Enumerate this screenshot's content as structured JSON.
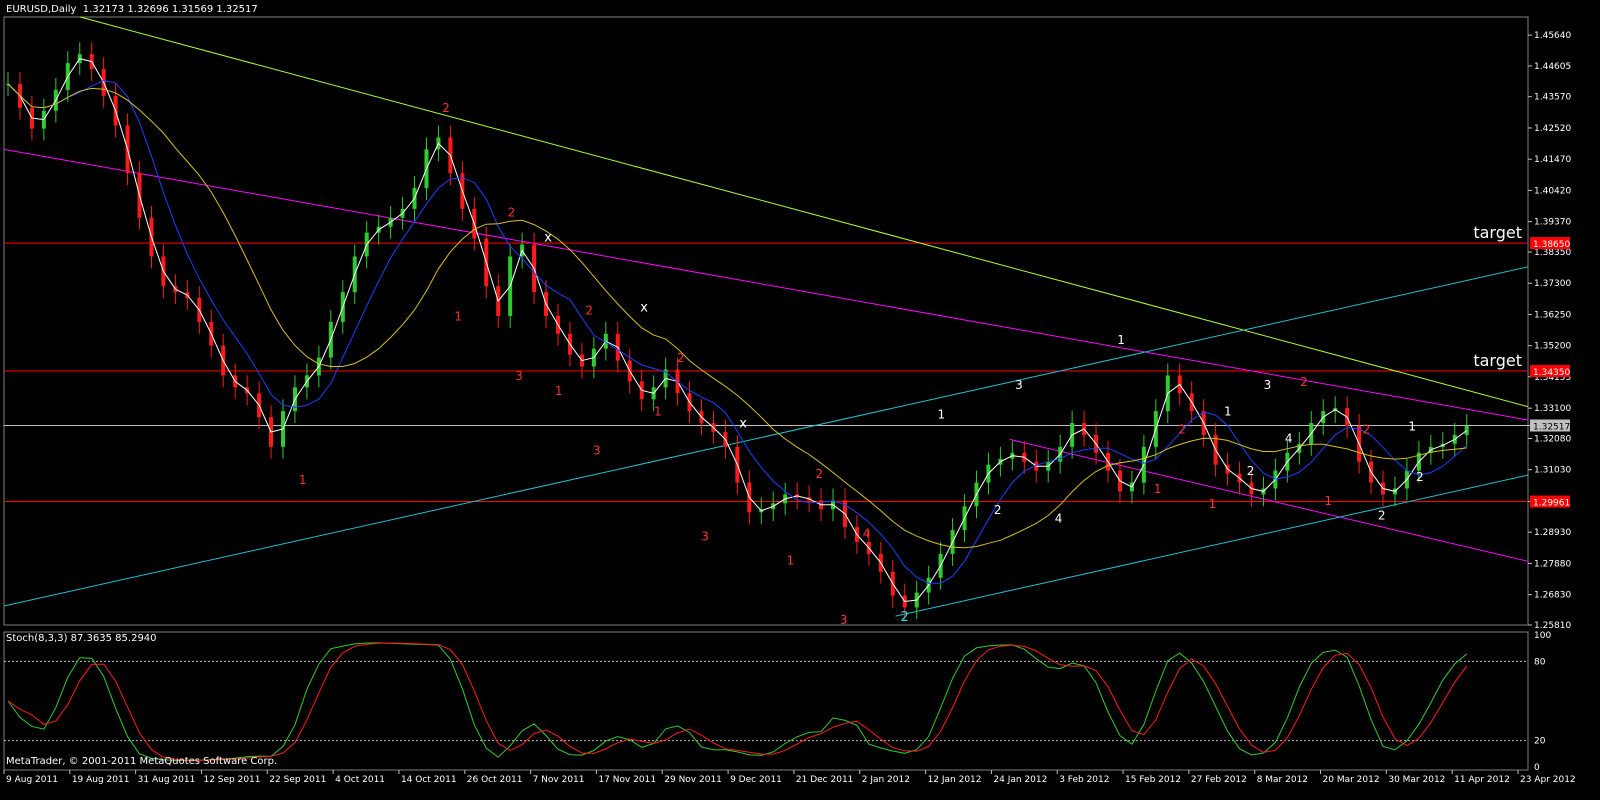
{
  "header": {
    "symbol_label": "EURUSD,Daily",
    "ohlc": "1.32173 1.32696 1.31569 1.32517"
  },
  "indicator": {
    "label": "Stoch(8,3,3) 87.3635 85.2940",
    "levels": [
      "100",
      "80",
      "20",
      "0"
    ]
  },
  "copyright": "MetaTrader, © 2001-2011 MetaQuotes Software Corp.",
  "chart_data": {
    "type": "candlestick",
    "symbol": "EURUSD",
    "timeframe": "Daily",
    "price_axis_labels": [
      "1.45640",
      "1.44605",
      "1.43570",
      "1.42520",
      "1.41470",
      "1.40420",
      "1.39370",
      "1.38350",
      "1.37300",
      "1.36250",
      "1.35200",
      "1.34155",
      "1.33100",
      "1.32517",
      "1.32080",
      "1.31030",
      "1.29961",
      "1.28930",
      "1.27880",
      "1.26830",
      "1.25810"
    ],
    "ylim": [
      1.2581,
      1.4625
    ],
    "time_axis_labels": [
      "9 Aug 2011",
      "19 Aug 2011",
      "31 Aug 2011",
      "12 Sep 2011",
      "22 Sep 2011",
      "4 Oct 2011",
      "14 Oct 2011",
      "26 Oct 2011",
      "7 Nov 2011",
      "17 Nov 2011",
      "29 Nov 2011",
      "9 Dec 2011",
      "21 Dec 2011",
      "2 Jan 2012",
      "12 Jan 2012",
      "24 Jan 2012",
      "3 Feb 2012",
      "15 Feb 2012",
      "27 Feb 2012",
      "8 Mar 2012",
      "20 Mar 2012",
      "30 Mar 2012",
      "11 Apr 2012",
      "23 Apr 2012"
    ],
    "current_price": 1.32517,
    "price_series": [
      1.44,
      1.432,
      1.425,
      1.431,
      1.438,
      1.447,
      1.45,
      1.445,
      1.436,
      1.426,
      1.41,
      1.395,
      1.382,
      1.372,
      1.37,
      1.368,
      1.36,
      1.352,
      1.342,
      1.338,
      1.336,
      1.328,
      1.318,
      1.33,
      1.338,
      1.342,
      1.348,
      1.36,
      1.37,
      1.382,
      1.39,
      1.392,
      1.395,
      1.398,
      1.405,
      1.418,
      1.422,
      1.41,
      1.398,
      1.388,
      1.372,
      1.362,
      1.382,
      1.386,
      1.37,
      1.362,
      1.356,
      1.349,
      1.345,
      1.351,
      1.356,
      1.347,
      1.34,
      1.334,
      1.338,
      1.344,
      1.336,
      1.33,
      1.326,
      1.323,
      1.318,
      1.306,
      1.296,
      1.297,
      1.299,
      1.302,
      1.301,
      1.3,
      1.297,
      1.3,
      1.291,
      1.286,
      1.282,
      1.276,
      1.268,
      1.264,
      1.269,
      1.274,
      1.282,
      1.29,
      1.298,
      1.306,
      1.312,
      1.314,
      1.316,
      1.313,
      1.31,
      1.313,
      1.318,
      1.326,
      1.322,
      1.316,
      1.31,
      1.303,
      1.306,
      1.318,
      1.33,
      1.342,
      1.336,
      1.33,
      1.322,
      1.312,
      1.309,
      1.306,
      1.302,
      1.304,
      1.31,
      1.316,
      1.319,
      1.326,
      1.33,
      1.331,
      1.325,
      1.313,
      1.306,
      1.302,
      1.304,
      1.31,
      1.316,
      1.318,
      1.319,
      1.322,
      1.325
    ],
    "horizontal_lines": [
      {
        "price": 1.3865,
        "label": "target",
        "color": "#ff0000"
      },
      {
        "price": 1.3435,
        "label": "target",
        "color": "#ff0000"
      },
      {
        "price": 1.32517,
        "label": "",
        "color": "#c0c0c0"
      },
      {
        "price": 1.29961,
        "label": "",
        "color": "#ff0000"
      }
    ],
    "annotations": [
      {
        "text": "2",
        "color": "#ff3030",
        "t": 0.29,
        "p": 1.4305
      },
      {
        "text": "2",
        "color": "#ff3030",
        "t": 0.333,
        "p": 1.3955
      },
      {
        "text": "x",
        "color": "#ffffff",
        "t": 0.357,
        "p": 1.387
      },
      {
        "text": "1",
        "color": "#ff3030",
        "t": 0.196,
        "p": 1.3055
      },
      {
        "text": "1",
        "color": "#ff3030",
        "t": 0.298,
        "p": 1.3605
      },
      {
        "text": "3",
        "color": "#ff3030",
        "t": 0.338,
        "p": 1.3405
      },
      {
        "text": "1",
        "color": "#ff3030",
        "t": 0.364,
        "p": 1.3355
      },
      {
        "text": "2",
        "color": "#ff3030",
        "t": 0.384,
        "p": 1.3625
      },
      {
        "text": "x",
        "color": "#ffffff",
        "t": 0.42,
        "p": 1.3635
      },
      {
        "text": "3",
        "color": "#ff3030",
        "t": 0.389,
        "p": 1.3155
      },
      {
        "text": "1",
        "color": "#ff3030",
        "t": 0.429,
        "p": 1.3285
      },
      {
        "text": "2",
        "color": "#ff3030",
        "t": 0.444,
        "p": 1.3465
      },
      {
        "text": "x",
        "color": "#ffffff",
        "t": 0.485,
        "p": 1.3245
      },
      {
        "text": "3",
        "color": "#ff3030",
        "t": 0.46,
        "p": 1.2865
      },
      {
        "text": "1",
        "color": "#ff3030",
        "t": 0.516,
        "p": 1.2785
      },
      {
        "text": "2",
        "color": "#ff3030",
        "t": 0.535,
        "p": 1.3075
      },
      {
        "text": "4",
        "color": "#ff3030",
        "t": 0.566,
        "p": 1.2875
      },
      {
        "text": "3",
        "color": "#ff3030",
        "t": 0.551,
        "p": 1.2585
      },
      {
        "text": "2",
        "color": "#20e0e0",
        "t": 0.591,
        "p": 1.2595
      },
      {
        "text": "1",
        "color": "#ffffff",
        "t": 0.615,
        "p": 1.3275
      },
      {
        "text": "2",
        "color": "#ffffff",
        "t": 0.652,
        "p": 1.2955
      },
      {
        "text": "3",
        "color": "#ffffff",
        "t": 0.666,
        "p": 1.3375
      },
      {
        "text": "4",
        "color": "#ffffff",
        "t": 0.692,
        "p": 1.2925
      },
      {
        "text": "1",
        "color": "#ffffff",
        "t": 0.733,
        "p": 1.3525
      },
      {
        "text": "1",
        "color": "#ff3030",
        "t": 0.757,
        "p": 1.3025
      },
      {
        "text": "2",
        "color": "#ff3030",
        "t": 0.773,
        "p": 1.3225
      },
      {
        "text": "1",
        "color": "#ff3030",
        "t": 0.793,
        "p": 1.2975
      },
      {
        "text": "1",
        "color": "#ffffff",
        "t": 0.803,
        "p": 1.3285
      },
      {
        "text": "2",
        "color": "#ffffff",
        "t": 0.818,
        "p": 1.3085
      },
      {
        "text": "4",
        "color": "#ffffff",
        "t": 0.843,
        "p": 1.3195
      },
      {
        "text": "3",
        "color": "#ffffff",
        "t": 0.829,
        "p": 1.3375
      },
      {
        "text": "2",
        "color": "#ff3030",
        "t": 0.853,
        "p": 1.3385
      },
      {
        "text": "2",
        "color": "#ff3030",
        "t": 0.894,
        "p": 1.3225
      },
      {
        "text": "1",
        "color": "#ff3030",
        "t": 0.869,
        "p": 1.2985
      },
      {
        "text": "1",
        "color": "#ffffff",
        "t": 0.924,
        "p": 1.3235
      },
      {
        "text": "2",
        "color": "#ffffff",
        "t": 0.929,
        "p": 1.3065
      },
      {
        "text": "2",
        "color": "#ffffff",
        "t": 0.904,
        "p": 1.2935
      }
    ]
  }
}
